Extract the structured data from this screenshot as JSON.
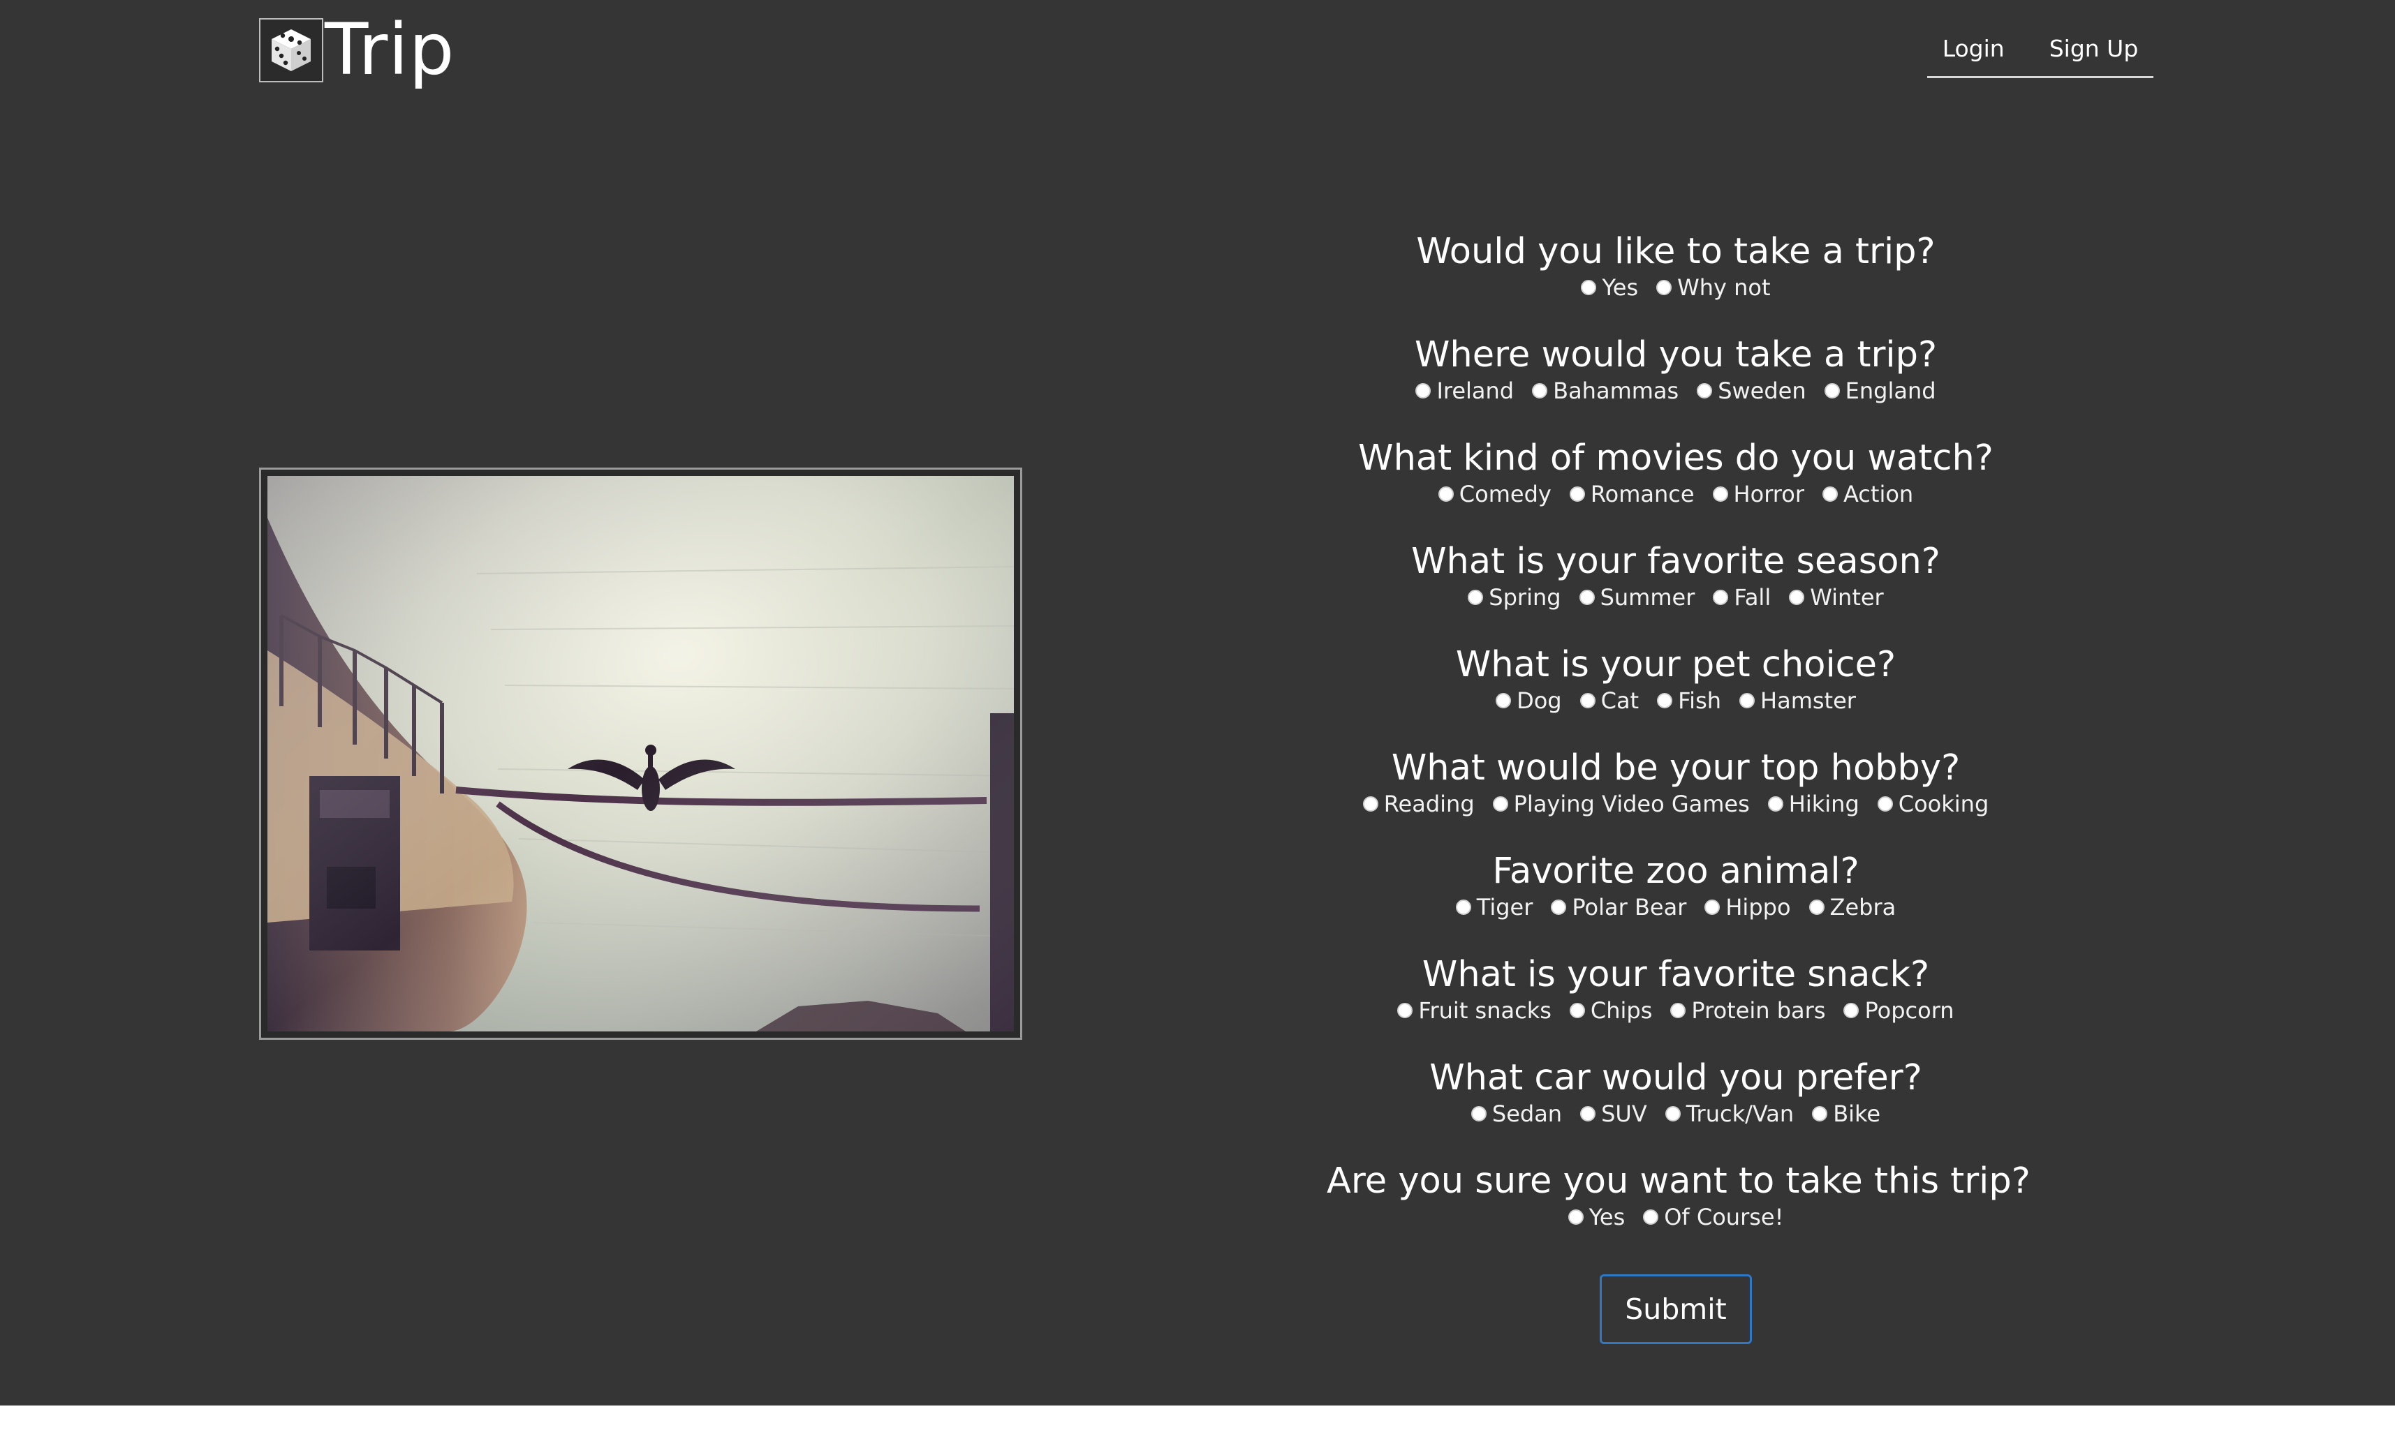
{
  "brand": {
    "name": "Trip",
    "icon": "dice-icon"
  },
  "nav": {
    "login": "Login",
    "signup": "Sign Up"
  },
  "photo": {
    "alt": "Cormorant spreading wings on a mooring rope beside an old boat on the water",
    "icon": "photo"
  },
  "questions": [
    {
      "title": "Would you like to take a trip?",
      "options": [
        "Yes",
        "Why not"
      ]
    },
    {
      "title": "Where would you take a trip?",
      "options": [
        "Ireland",
        "Bahammas",
        "Sweden",
        "England"
      ]
    },
    {
      "title": "What kind of movies do you watch?",
      "options": [
        "Comedy",
        "Romance",
        "Horror",
        "Action"
      ]
    },
    {
      "title": "What is your favorite season?",
      "options": [
        "Spring",
        "Summer",
        "Fall",
        "Winter"
      ]
    },
    {
      "title": "What is your pet choice?",
      "options": [
        "Dog",
        "Cat",
        "Fish",
        "Hamster"
      ]
    },
    {
      "title": "What would be your top hobby?",
      "options": [
        "Reading",
        "Playing Video Games",
        "Hiking",
        "Cooking"
      ]
    },
    {
      "title": "Favorite zoo animal?",
      "options": [
        "Tiger",
        "Polar Bear",
        "Hippo",
        "Zebra"
      ]
    },
    {
      "title": "What is your favorite snack?",
      "options": [
        "Fruit snacks",
        "Chips",
        "Protein bars",
        "Popcorn"
      ]
    },
    {
      "title": "What car would you prefer?",
      "options": [
        "Sedan",
        "SUV",
        "Truck/Van",
        "Bike"
      ]
    },
    {
      "title": "Are you sure you want to take this trip?",
      "options": [
        "Yes",
        "Of Course!"
      ]
    }
  ],
  "submit": "Submit",
  "colors": {
    "background": "#353535",
    "accent": "#2f78c4",
    "text": "#ffffff"
  }
}
